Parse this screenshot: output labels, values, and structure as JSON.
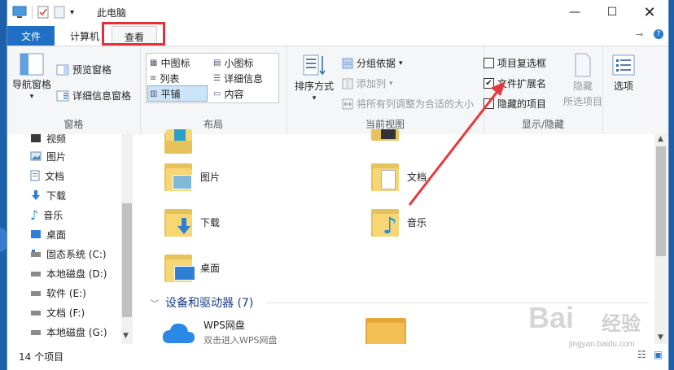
{
  "window": {
    "title": "此电脑"
  },
  "tabs": {
    "file": "文件",
    "computer": "计算机",
    "view": "查看"
  },
  "ribbon": {
    "pane": {
      "nav_pane": "导航窗格",
      "preview_pane": "预览窗格",
      "details_pane": "详细信息窗格",
      "label": "窗格"
    },
    "layout": {
      "items": [
        "中图标",
        "小图标",
        "列表",
        "详细信息",
        "平铺",
        "内容"
      ],
      "label": "布局"
    },
    "current_view": {
      "sort": "排序方式",
      "group_by": "分组依据",
      "add_column": "添加列",
      "fit_columns": "将所有列调整为合适的大小",
      "label": "当前视图"
    },
    "show_hide": {
      "item_checkboxes": "项目复选框",
      "file_extensions": "文件扩展名",
      "hidden_items": "隐藏的项目",
      "hide_selected_1": "隐藏",
      "hide_selected_2": "所选项目",
      "label": "显示/隐藏"
    },
    "options": {
      "label": "选项"
    }
  },
  "nav": {
    "items": [
      "视频",
      "图片",
      "文档",
      "下载",
      "音乐",
      "桌面",
      "固态系统 (C:)",
      "本地磁盘 (D:)",
      "软件 (E:)",
      "文档 (F:)",
      "本地磁盘 (G:)"
    ]
  },
  "content": {
    "folders": [
      "图片",
      "文档",
      "下载",
      "音乐",
      "桌面"
    ],
    "section_title": "设备和驱动器 (7)",
    "wps_name": "WPS网盘",
    "wps_desc": "双击进入WPS网盘"
  },
  "status": {
    "count": "14 个项目"
  },
  "watermark": {
    "brand": "Bai",
    "brand2": "经验",
    "url": "jingyan.baidu.com"
  },
  "colors": {
    "accent": "#1f6fc5",
    "highlight": "#e0323a",
    "folder": "#f7d774",
    "section": "#1a3e8c"
  }
}
